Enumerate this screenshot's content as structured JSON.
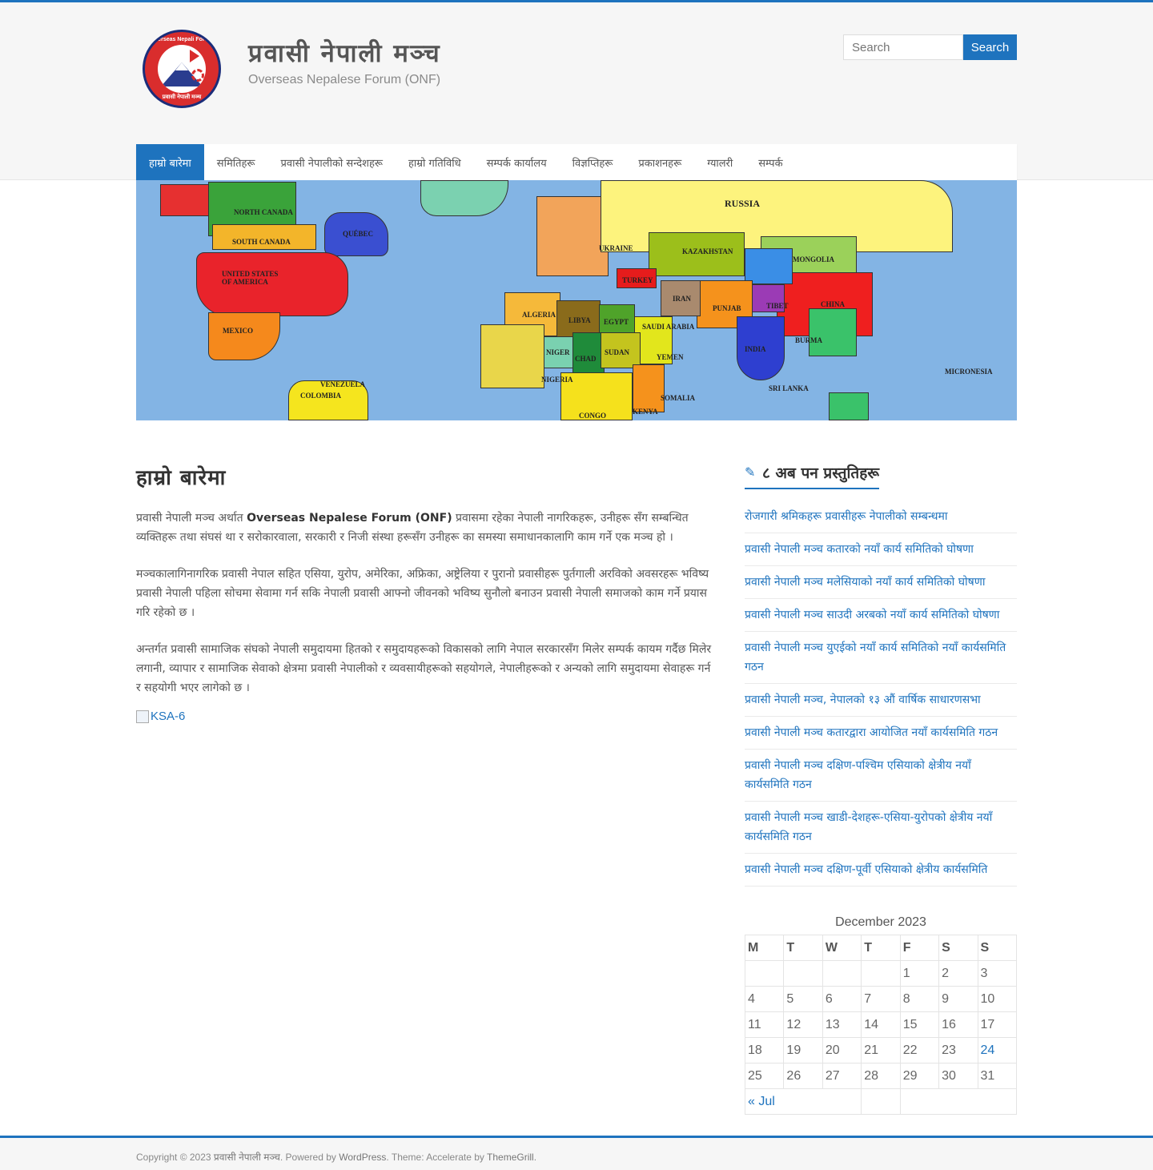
{
  "header": {
    "site_title": "प्रवासी नेपाली मञ्च",
    "site_description": "Overseas Nepalese Forum (ONF)",
    "logo_text_top": "Overseas Nepali Forum",
    "logo_text_bottom": "प्रवासी नेपाली मञ्च",
    "search_placeholder": "Search",
    "search_button": "Search"
  },
  "nav": {
    "items": [
      {
        "label": "हाम्रो बारेमा"
      },
      {
        "label": "समितिहरू"
      },
      {
        "label": "प्रवासी नेपालीको सन्देशहरू"
      },
      {
        "label": "हाम्रो गतिविधि"
      },
      {
        "label": "सम्पर्क कार्यालय"
      },
      {
        "label": "विज्ञप्तिहरू"
      },
      {
        "label": "प्रकाशनहरू"
      },
      {
        "label": "ग्यालरी"
      },
      {
        "label": "सम्पर्क"
      }
    ]
  },
  "banner": {
    "labels": [
      "NORTH CANADA",
      "SOUTH CANADA",
      "QUÉBEC",
      "UNITED STATES",
      "OF AMERICA",
      "MEXICO",
      "RUSSIA",
      "KAZAKHSTAN",
      "MONGOLIA",
      "CHINA",
      "TIBET",
      "PUNJAB",
      "INDIA",
      "IRAN",
      "TURKEY",
      "UKRAINE",
      "ALGERIA",
      "LIBYA",
      "EGYPT",
      "NIGER",
      "CHAD",
      "SUDAN",
      "NIGERIA",
      "CONGO",
      "SOMALIA",
      "KENYA",
      "SAUDI ARABIA",
      "YEMEN",
      "BURMA",
      "COLOMBIA",
      "VENEZUELA",
      "SRI LANKA",
      "MICRONESIA"
    ]
  },
  "content": {
    "title": "हाम्रो बारेमा",
    "p1_before": "प्रवासी नेपाली मञ्च अर्थात",
    "p1_bold": "Overseas Nepalese Forum (ONF)",
    "p1_after": "प्रवासमा रहेका नेपाली नागरिकहरू, उनीहरू सँग सम्बन्धित व्यक्तिहरू तथा संघसं था र सरोकारवाला, सरकारी र निजी संस्था हरूसँग उनीहरू का समस्या समाधानकालागि काम गर्ने एक मञ्च हो ।",
    "p2": "मञ्चकालागिनागरिक प्रवासी नेपाल सहित एसिया, युरोप, अमेरिका, अफ्रिका, अष्ट्रेलिया र पुरानो प्रवासीहरू पुर्तगाली अरविको अवसरहरू भविष्य प्रवासी नेपाली पहिला सोचमा सेवामा गर्न सकि नेपाली प्रवासी आफ्नो जीवनको भविष्य सुनौलो बनाउन प्रवासी नेपाली समाजको काम गर्ने प्रयास गरि रहेको छ ।",
    "p3": "अन्तर्गत प्रवासी सामाजिक संघको नेपाली समुदायमा हितको र समुदायहरूको विकासको लागि नेपाल सरकारसँग मिलेर सम्पर्क कायम गर्दैछ मिलेर लगानी, व्यापार र सामाजिक सेवाको क्षेत्रमा प्रवासी नेपालीको र व्यवसायीहरूको सहयोगले, नेपालीहरूको र अन्यको लागि समुदायमा सेवाहरू गर्न र सहयोगी भएर लागेको छ ।",
    "image_alt": "KSA-6"
  },
  "sidebar": {
    "widget_title": "८ अब पन प्रस्तुतिहरू",
    "posts": [
      "रोजगारी श्रमिकहरू प्रवासीहरू नेपालीको सम्बन्धमा",
      "प्रवासी नेपाली मञ्च कतारको नयाँ कार्य समितिको घोषणा",
      "प्रवासी नेपाली मञ्च मलेसियाको नयाँ कार्य समितिको घोषणा",
      "प्रवासी नेपाली मञ्च साउदी अरबको नयाँ कार्य समितिको घोषणा",
      "प्रवासी नेपाली मञ्च युएईको नयाँ कार्य समितिको नयाँ कार्यसमिति गठन",
      "प्रवासी नेपाली मञ्च, नेपालको १३ औं वार्षिक साधारणसभा",
      "प्रवासी नेपाली मञ्च कतारद्वारा आयोजित नयाँ कार्यसमिति गठन",
      "प्रवासी नेपाली मञ्च दक्षिण-पश्चिम एसियाको क्षेत्रीय नयाँ कार्यसमिति गठन",
      "प्रवासी नेपाली मञ्च खाडी-देशहरू-एसिया-युरोपको क्षेत्रीय नयाँ कार्यसमिति गठन",
      "प्रवासी नेपाली मञ्च दक्षिण-पूर्वी एसियाको क्षेत्रीय कार्यसमिति"
    ]
  },
  "calendar": {
    "caption": "December 2023",
    "headers": [
      "M",
      "T",
      "W",
      "T",
      "F",
      "S",
      "S"
    ],
    "weeks": [
      [
        "",
        "",
        "",
        "",
        "1",
        "2",
        "3"
      ],
      [
        "4",
        "5",
        "6",
        "7",
        "8",
        "9",
        "10"
      ],
      [
        "11",
        "12",
        "13",
        "14",
        "15",
        "16",
        "17"
      ],
      [
        "18",
        "19",
        "20",
        "21",
        "22",
        "23",
        "24"
      ],
      [
        "25",
        "26",
        "27",
        "28",
        "29",
        "30",
        "31"
      ]
    ],
    "linked_day": "24",
    "prev_label": "« Jul"
  },
  "footer": {
    "copyright": "Copyright © 2023",
    "site_link": "प्रवासी नेपाली मञ्च",
    "powered": ". Powered by",
    "wordpress": "WordPress",
    "theme": ". Theme: Accelerate by",
    "themegrill": "ThemeGrill",
    "end": "."
  },
  "colors": {
    "accent": "#1e73be",
    "header_bg": "#f6f6f6",
    "ocean": "#83b4e4"
  }
}
